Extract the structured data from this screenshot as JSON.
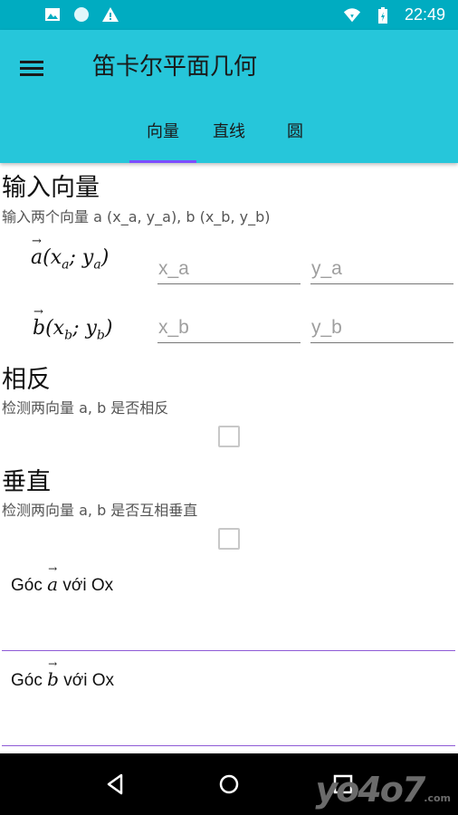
{
  "status_bar": {
    "time": "22:49",
    "left_icons": [
      "image-icon",
      "circle-icon",
      "warning-icon"
    ],
    "right_icons": [
      "wifi-icon",
      "battery-icon"
    ]
  },
  "app_bar": {
    "title": "笛卡尔平面几何",
    "menu_icon": "menu-icon",
    "tabs": [
      {
        "label": "向量",
        "active": true
      },
      {
        "label": "直线",
        "active": false
      },
      {
        "label": "圆",
        "active": false
      }
    ],
    "colors": {
      "status": "#00acc1",
      "bar": "#26c6da",
      "indicator": "#7c4dff"
    }
  },
  "input_section": {
    "title": "输入向量",
    "subtitle": "输入两个向量 a (x_a, y_a), b (x_b, y_b)",
    "vector_a": {
      "name": "a",
      "x_sub": "a",
      "y_sub": "a",
      "x_placeholder": "x_a",
      "y_placeholder": "y_a"
    },
    "vector_b": {
      "name": "b",
      "x_sub": "b",
      "y_sub": "b",
      "x_placeholder": "x_b",
      "y_placeholder": "y_b"
    }
  },
  "opposite_section": {
    "title": "相反",
    "subtitle": "检测两向量 a, b 是否相反",
    "checked": false
  },
  "perpendicular_section": {
    "title": "垂直",
    "subtitle": "检测两向量 a, b 是否互相垂直",
    "checked": false
  },
  "angle_a": {
    "prefix": "Góc",
    "vector": "a",
    "suffix": "với Ox"
  },
  "angle_b": {
    "prefix": "Góc",
    "vector": "b",
    "suffix": "với Ox"
  },
  "watermark": {
    "text": "yo4o7",
    "domain": ".com"
  },
  "nav_bar": {
    "buttons": [
      "back-icon",
      "home-icon",
      "recents-icon"
    ]
  }
}
